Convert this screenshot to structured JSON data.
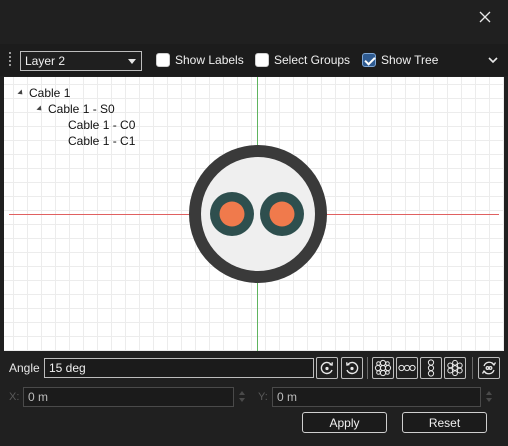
{
  "window": {
    "close_icon": "close-icon"
  },
  "toolbar": {
    "layer_value": "Layer 2",
    "show_labels": {
      "label": "Show Labels",
      "checked": false
    },
    "select_groups": {
      "label": "Select Groups",
      "checked": false
    },
    "show_tree": {
      "label": "Show Tree",
      "checked": true
    }
  },
  "tree": [
    {
      "label": "Cable 1",
      "level": 0,
      "expanded": true
    },
    {
      "label": "Cable 1 - S0",
      "level": 1,
      "expanded": true
    },
    {
      "label": "Cable 1 - C0",
      "level": 2,
      "expanded": false
    },
    {
      "label": "Cable 1 - C1",
      "level": 2,
      "expanded": false
    }
  ],
  "colors": {
    "jacket": "#3a3a3a",
    "filler": "#efefef",
    "insulation": "#2e4f4e",
    "conductor": "#f07a4c",
    "axis_x": "#e06060",
    "axis_y": "#5fb45f"
  },
  "angle": {
    "label": "Angle",
    "value": "15 deg"
  },
  "tools": [
    "rotate-cw-icon",
    "rotate-ccw-icon",
    "bundle-circular-icon",
    "bundle-horizontal-icon",
    "bundle-vertical-icon",
    "bundle-flower-icon",
    "twist-icon"
  ],
  "position": {
    "x_label": "X:",
    "x_value": "0 m",
    "y_label": "Y:",
    "y_value": "0 m"
  },
  "buttons": {
    "apply": "Apply",
    "reset": "Reset"
  }
}
